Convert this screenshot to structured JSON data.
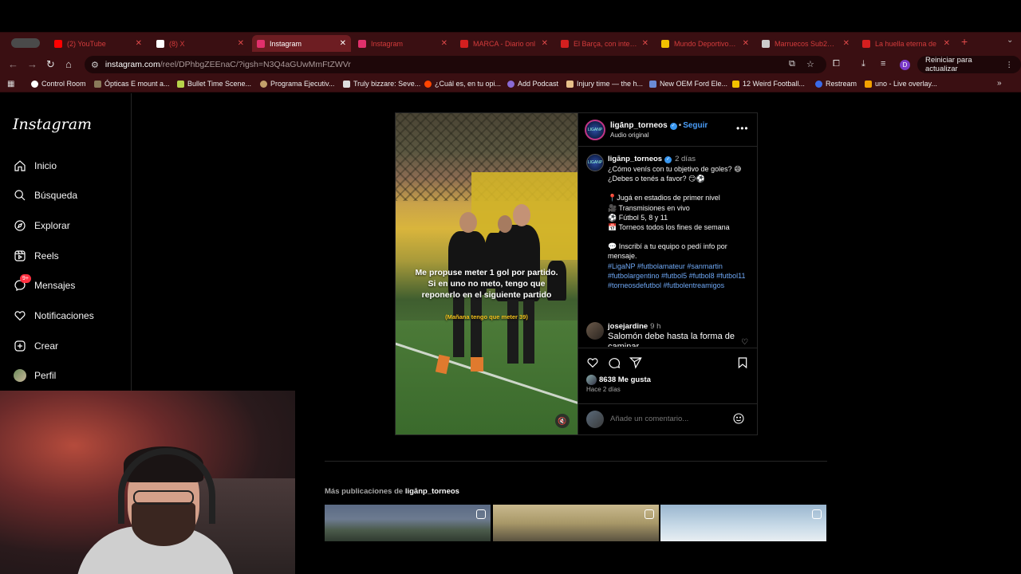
{
  "browser": {
    "tabs": [
      {
        "title": "(2) YouTube",
        "favicon_color": "#ff0000",
        "active": false
      },
      {
        "title": "(8) X",
        "favicon_color": "#ffffff",
        "active": false
      },
      {
        "title": "Instagram",
        "favicon_color": "#e1306c",
        "active": true
      },
      {
        "title": "Instagram",
        "favicon_color": "#e1306c",
        "active": false
      },
      {
        "title": "MARCA - Diario onl",
        "favicon_color": "#d41f1f",
        "active": false
      },
      {
        "title": "El Barça, con intenc",
        "favicon_color": "#d41f1f",
        "active": false
      },
      {
        "title": "Mundo Deportivo | M",
        "favicon_color": "#f2c100",
        "active": false
      },
      {
        "title": "Marruecos Sub20 G",
        "favicon_color": "#cccccc",
        "active": false
      },
      {
        "title": "La huella eterna de",
        "favicon_color": "#d41f1f",
        "active": false
      }
    ],
    "new_tab_symbol": "+",
    "url_host": "instagram.com",
    "url_path": "/reel/DPhbgZEEnaC/?igsh=N3Q4aGUwMmFtZWVr",
    "update_button": "Reiniciar para actualizar",
    "profile_initial": "D",
    "bookmarks": [
      {
        "label": "Control Room",
        "color": "#ffffff"
      },
      {
        "label": "Ópticas E mount a...",
        "color": "#8a7a5a"
      },
      {
        "label": "Bullet Time Scene...",
        "color": "#b7d34a"
      },
      {
        "label": "Programa Ejecutiv...",
        "color": "#c4a06a"
      },
      {
        "label": "Truly bizzare: Seve...",
        "color": "#dddddd"
      },
      {
        "label": "¿Cuál es, en tu opi...",
        "color": "#ff4500"
      },
      {
        "label": "Add Podcast",
        "color": "#8a6ad4"
      },
      {
        "label": "Injury time — the h...",
        "color": "#e8c08a"
      },
      {
        "label": "New OEM Ford Ele...",
        "color": "#6a8ad4"
      },
      {
        "label": "12 Weird Football...",
        "color": "#f2c100"
      },
      {
        "label": "Restream",
        "color": "#3a6ae8"
      },
      {
        "label": "uno - Live overlay...",
        "color": "#f2a100"
      }
    ]
  },
  "instagram": {
    "logo": "Instagram",
    "nav": [
      {
        "id": "inicio",
        "label": "Inicio",
        "icon": "home-icon"
      },
      {
        "id": "busqueda",
        "label": "Búsqueda",
        "icon": "search-icon"
      },
      {
        "id": "explorar",
        "label": "Explorar",
        "icon": "compass-icon"
      },
      {
        "id": "reels",
        "label": "Reels",
        "icon": "reels-icon"
      },
      {
        "id": "mensajes",
        "label": "Mensajes",
        "icon": "messenger-icon"
      },
      {
        "id": "notificaciones",
        "label": "Notificaciones",
        "icon": "heart-icon"
      },
      {
        "id": "crear",
        "label": "Crear",
        "icon": "plus-square-icon"
      },
      {
        "id": "perfil",
        "label": "Perfil",
        "icon": "avatar"
      }
    ],
    "messages_badge": "9+",
    "post": {
      "username": "ligānp_torneos",
      "follow_label": "Seguir",
      "audio": "Audio original",
      "avatar_text": "LIGANP",
      "reel_caption": "Me propuse meter 1 gol por partido. Si en uno no meto, tengo que reponerlo en el siguiente partido",
      "reel_sub": "(Mañana tengo que meter 39)",
      "caption_time": "2 días",
      "caption_lines": [
        "¿Cómo venís con tu objetivo de goles? 😅",
        "¿Debes o tenés a favor? 😏⚽"
      ],
      "bullets": [
        "📍Jugá en estadios de primer nivel",
        "🎥 Transmisiones en vivo",
        "⚽ Fútbol 5, 8 y 11",
        "📅 Torneos todos los fines de semana"
      ],
      "cta": "💬 Inscribí a tu equipo o pedí info por mensaje.",
      "hashtags": "#LigaNP #futbolamateur #sanmartin #futbolargentino #futbol5 #futbol8 #futbol11 #torneosdefutbol #futbolentreamigos",
      "comment": {
        "user": "josejardine",
        "time": "9 h",
        "text": "Salomón debe hasta la forma de caminar"
      },
      "likes": "8638 Me gusta",
      "posted_ago": "Hace 2 días",
      "comment_placeholder": "Añade un comentario..."
    },
    "more_posts": {
      "prefix": "Más publicaciones de ",
      "user": "ligānp_torneos"
    }
  }
}
